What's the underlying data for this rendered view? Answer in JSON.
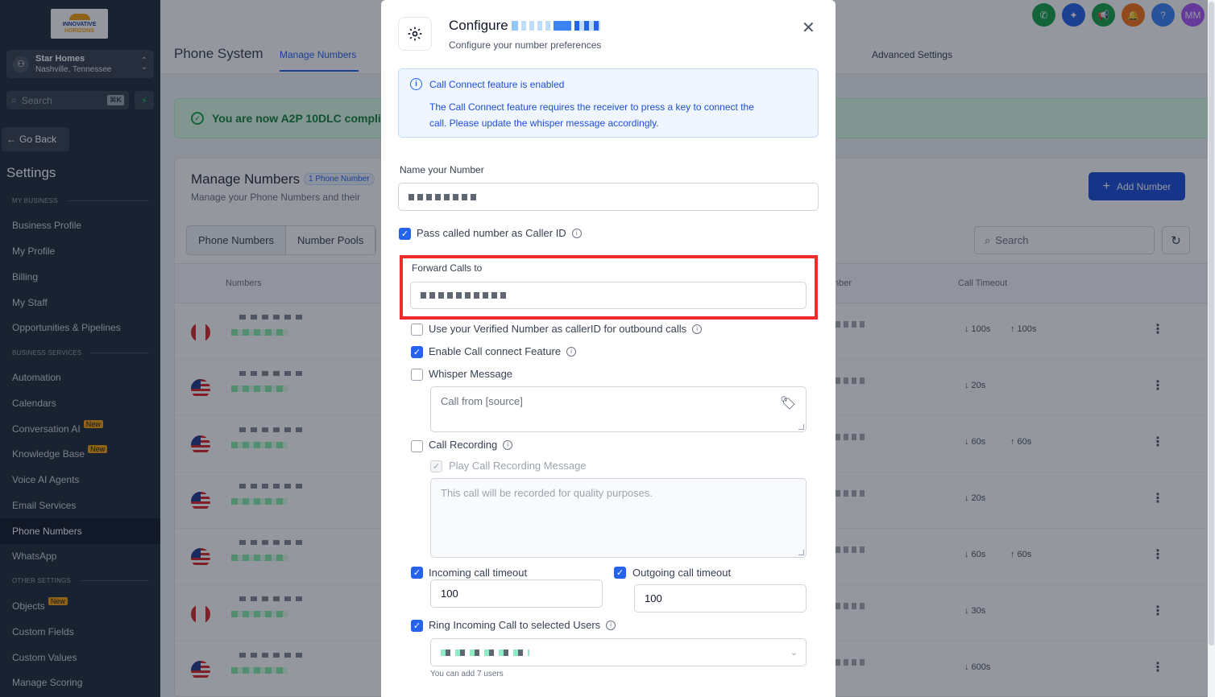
{
  "sidebar": {
    "logo_line1": "INNOVATIVE",
    "logo_line2": "HORIZONS",
    "location_name": "Star Homes",
    "location_city": "Nashville, Tennessee",
    "search_placeholder": "Search",
    "search_shortcut": "⌘K",
    "go_back": "Go Back",
    "settings_title": "Settings",
    "section_my_business": "MY BUSINESS",
    "section_business_services": "BUSINESS SERVICES",
    "section_other_settings": "OTHER SETTINGS",
    "new_badge": "New",
    "items": {
      "business_profile": "Business Profile",
      "my_profile": "My Profile",
      "billing": "Billing",
      "my_staff": "My Staff",
      "opportunities": "Opportunities & Pipelines",
      "automation": "Automation",
      "calendars": "Calendars",
      "conversation_ai": "Conversation AI",
      "knowledge_base": "Knowledge Base",
      "voice_ai": "Voice AI Agents",
      "email_services": "Email Services",
      "phone_numbers": "Phone Numbers",
      "whatsapp": "WhatsApp",
      "objects": "Objects",
      "custom_fields": "Custom Fields",
      "custom_values": "Custom Values",
      "manage_scoring": "Manage Scoring"
    }
  },
  "header": {
    "page_title": "Phone System",
    "tab_manage": "Manage Numbers",
    "tab_advanced": "Advanced Settings",
    "user_initials": "MM",
    "help": "?"
  },
  "page": {
    "a2p_notice": "You are now A2P 10DLC complia",
    "manage_title": "Manage Numbers",
    "phone_count_badge": "1 Phone Number",
    "manage_sub": "Manage your Phone Numbers and their",
    "add_number": "Add Number",
    "subtab_numbers": "Phone Numbers",
    "subtab_pools": "Number Pools",
    "search_placeholder": "Search",
    "col_numbers": "Numbers",
    "col_number": "mber",
    "col_timeout": "Call Timeout",
    "rows": [
      {
        "flag": "ca",
        "in": "↓ 100s",
        "out": "↑ 100s"
      },
      {
        "flag": "us",
        "in": "↓ 20s",
        "out": ""
      },
      {
        "flag": "us",
        "in": "↓ 60s",
        "out": "↑ 60s"
      },
      {
        "flag": "us",
        "in": "↓ 20s",
        "out": ""
      },
      {
        "flag": "us",
        "in": "↓ 60s",
        "out": "↑ 60s"
      },
      {
        "flag": "ca",
        "in": "↓ 30s",
        "out": ""
      },
      {
        "flag": "us",
        "in": "↓ 600s",
        "out": ""
      }
    ]
  },
  "modal": {
    "title": "Configure",
    "subtitle": "Configure your number preferences",
    "info_title": "Call Connect feature is enabled",
    "info_body": "The Call Connect feature requires the receiver to press a key to connect the call. Please update the whisper message accordingly.",
    "name_label": "Name your Number",
    "pass_caller_id": "Pass called number as Caller ID",
    "forward_label": "Forward Calls to",
    "verified_number": "Use your Verified Number as callerID for outbound calls",
    "call_connect": "Enable Call connect Feature",
    "whisper": "Whisper Message",
    "whisper_placeholder": "Call from [source]",
    "call_recording": "Call Recording",
    "play_recording": "Play Call Recording Message",
    "recording_placeholder": "This call will be recorded for quality purposes.",
    "incoming_timeout": "Incoming call timeout",
    "incoming_value": "100",
    "outgoing_timeout": "Outgoing call timeout",
    "outgoing_value": "100",
    "ring_users": "Ring Incoming Call to selected Users",
    "users_hint": "You can add 7 users"
  },
  "colors": {
    "accent": "#2563eb",
    "sidebar": "#1f2a37",
    "highlight": "#ef2b2b"
  }
}
